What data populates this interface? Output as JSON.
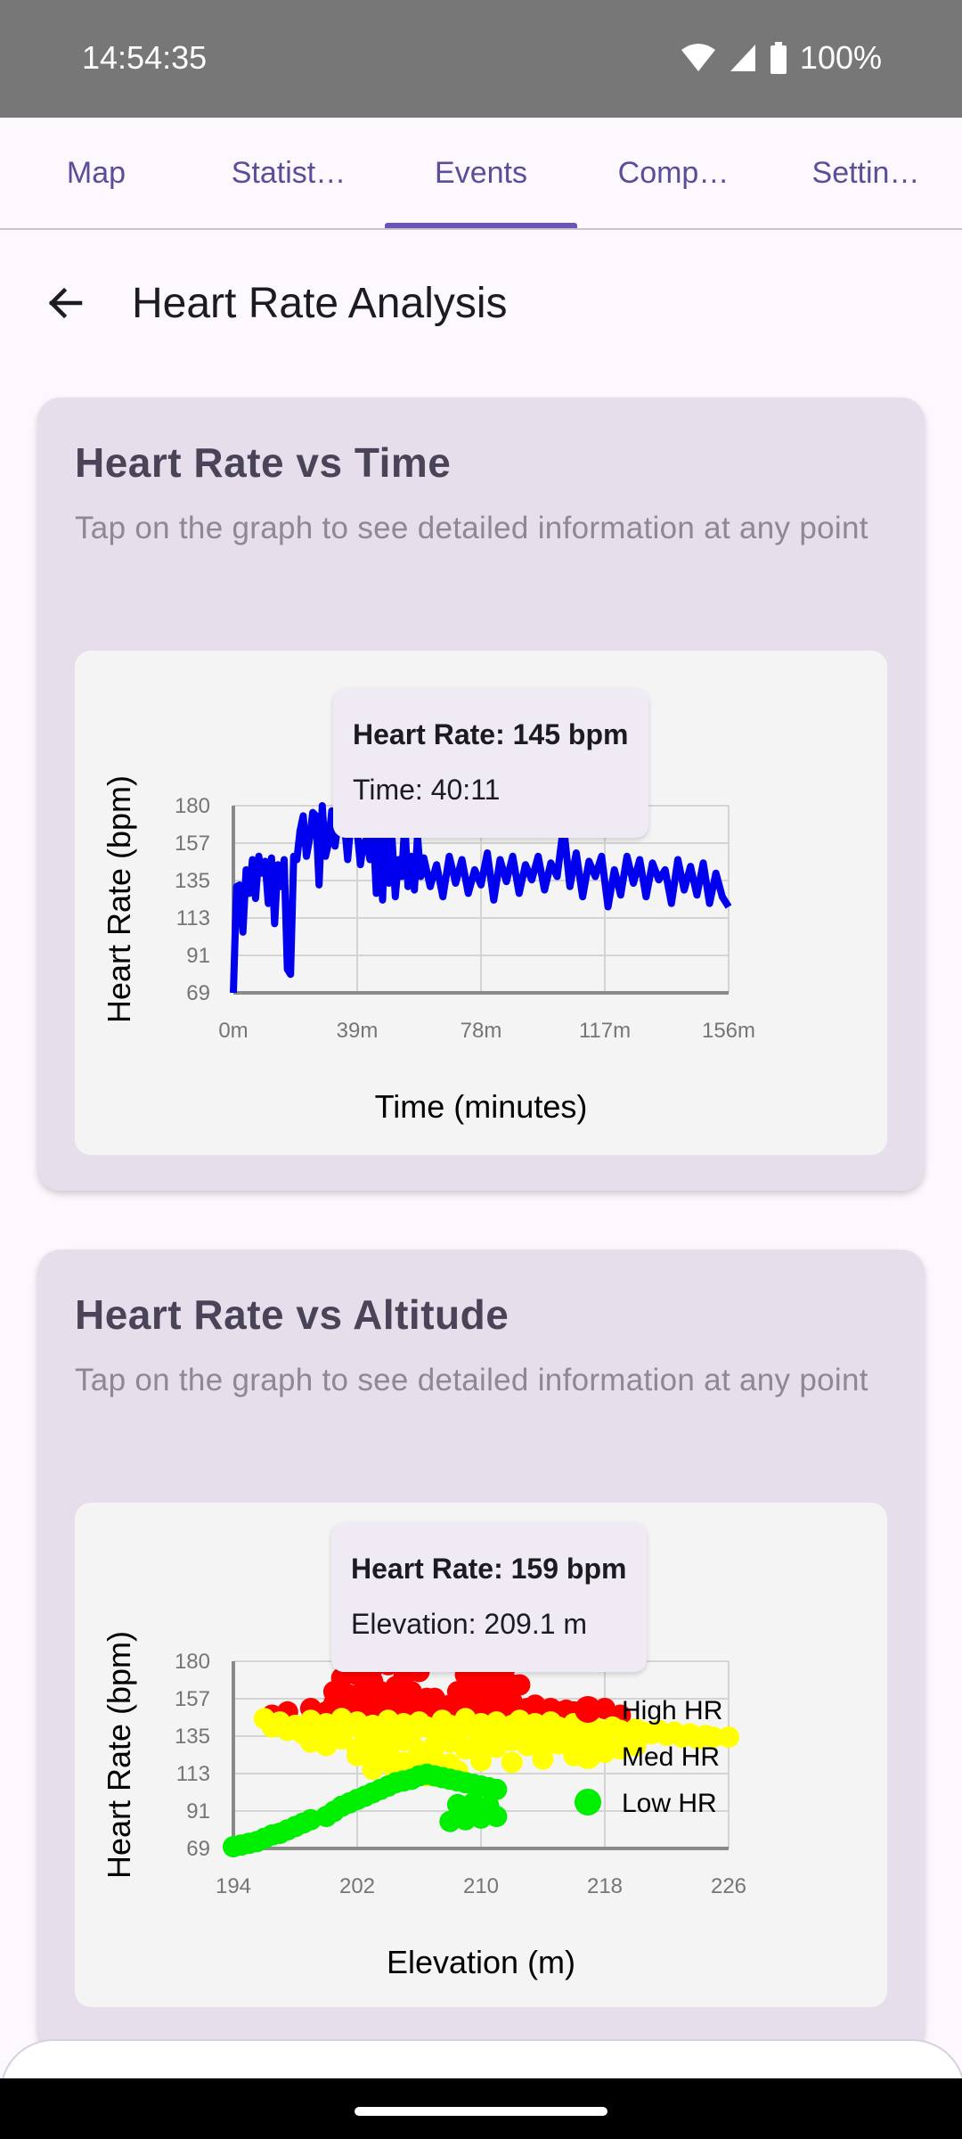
{
  "status_bar": {
    "time": "14:54:35",
    "battery": "100%"
  },
  "tabs": [
    {
      "label": "Map"
    },
    {
      "label": "Statist…"
    },
    {
      "label": "Events"
    },
    {
      "label": "Comp…"
    },
    {
      "label": "Settin…"
    }
  ],
  "active_tab": "Events",
  "header": {
    "title": "Heart Rate Analysis"
  },
  "cards": [
    {
      "title": "Heart Rate vs Time",
      "description": "Tap on the graph to see detailed information at any point",
      "tooltip": {
        "line1": "Heart Rate: 145 bpm",
        "line2": "Time: 40:11"
      }
    },
    {
      "title": "Heart Rate vs Altitude",
      "description": "Tap on the graph to see detailed information at any point",
      "tooltip": {
        "line1": "Heart Rate: 159 bpm",
        "line2": "Elevation: 209.1 m"
      }
    }
  ],
  "chart_data": [
    {
      "type": "line",
      "xlabel": "Time (minutes)",
      "ylabel": "Heart Rate (bpm)",
      "x_ticks": [
        "0m",
        "39m",
        "78m",
        "117m",
        "156m"
      ],
      "y_ticks": [
        "69",
        "91",
        "113",
        "135",
        "157",
        "180"
      ],
      "xlim": [
        0,
        156
      ],
      "ylim": [
        69,
        180
      ],
      "grid": true,
      "color": "#0000ee",
      "x": [
        0,
        1,
        2,
        3,
        4,
        5,
        6,
        7,
        8,
        9,
        10,
        11,
        12,
        13,
        14,
        15,
        16,
        17,
        18,
        19,
        20,
        21,
        22,
        23,
        24,
        25,
        26,
        27,
        28,
        29,
        30,
        31,
        32,
        33,
        34,
        35,
        36,
        37,
        38,
        39,
        40,
        41,
        42,
        43,
        44,
        45,
        46,
        47,
        48,
        49,
        50,
        51,
        52,
        53,
        54,
        55,
        56,
        57,
        58,
        59,
        60,
        62,
        64,
        66,
        68,
        70,
        72,
        74,
        76,
        78,
        80,
        82,
        84,
        86,
        88,
        90,
        92,
        94,
        96,
        98,
        100,
        102,
        104,
        106,
        108,
        110,
        112,
        114,
        116,
        118,
        120,
        122,
        124,
        126,
        128,
        130,
        132,
        134,
        136,
        138,
        140,
        142,
        144,
        146,
        148,
        150,
        152,
        154,
        156
      ],
      "y": [
        69,
        132,
        133,
        105,
        142,
        128,
        148,
        125,
        150,
        140,
        147,
        122,
        149,
        110,
        145,
        132,
        148,
        83,
        80,
        150,
        148,
        165,
        174,
        150,
        160,
        176,
        174,
        133,
        180,
        150,
        158,
        177,
        156,
        170,
        174,
        170,
        148,
        170,
        172,
        165,
        145,
        158,
        160,
        148,
        170,
        128,
        162,
        124,
        176,
        134,
        160,
        126,
        148,
        138,
        170,
        132,
        150,
        130,
        162,
        138,
        149,
        132,
        145,
        126,
        150,
        134,
        148,
        128,
        142,
        133,
        152,
        124,
        148,
        135,
        150,
        128,
        145,
        136,
        150,
        130,
        146,
        138,
        168,
        132,
        152,
        126,
        147,
        138,
        150,
        120,
        142,
        127,
        150,
        134,
        148,
        126,
        146,
        136,
        142,
        122,
        148,
        130,
        144,
        127,
        146,
        122,
        140,
        126,
        120
      ]
    },
    {
      "type": "scatter",
      "xlabel": "Elevation (m)",
      "ylabel": "Heart Rate (bpm)",
      "x_ticks": [
        "194",
        "202",
        "210",
        "218",
        "226"
      ],
      "y_ticks": [
        "69",
        "91",
        "113",
        "135",
        "157",
        "180"
      ],
      "xlim": [
        194,
        226
      ],
      "ylim": [
        69,
        180
      ],
      "grid": true,
      "legend_position": "right",
      "series": [
        {
          "name": "High HR",
          "color": "#ff0000",
          "x": [
            196.5,
            197.5,
            199,
            200,
            200.5,
            201,
            201.5,
            202,
            202.5,
            203,
            203.5,
            204,
            204.5,
            205,
            205.5,
            206,
            206.5,
            207,
            207.5,
            208,
            208.5,
            209,
            209.5,
            210,
            210.5,
            211,
            211.5,
            212,
            212.5,
            213,
            213.5,
            214,
            214.5,
            215,
            215.5,
            216,
            217,
            218,
            219,
            200.5,
            201.5,
            202.5,
            203.5,
            204.5,
            205.5,
            206.5,
            208.5,
            209.5,
            210.5,
            211.5,
            212.5,
            201,
            202,
            203,
            205,
            209,
            210,
            211,
            212,
            201.5,
            203,
            204,
            206,
            209.5,
            210.5,
            211.5,
            204,
            205,
            209,
            210,
            211
          ],
          "y": [
            148,
            150,
            152,
            150,
            155,
            158,
            152,
            150,
            156,
            153,
            158,
            150,
            154,
            160,
            150,
            155,
            152,
            158,
            150,
            154,
            150,
            156,
            160,
            152,
            158,
            154,
            150,
            156,
            150,
            152,
            154,
            150,
            152,
            150,
            151,
            150,
            150,
            152,
            148,
            162,
            160,
            166,
            162,
            165,
            162,
            158,
            162,
            168,
            164,
            162,
            166,
            170,
            172,
            168,
            170,
            172,
            168,
            170,
            166,
            175,
            176,
            178,
            174,
            176,
            178,
            175,
            180,
            178,
            180,
            178,
            180
          ]
        },
        {
          "name": "Med HR",
          "color": "#ffff00",
          "x": [
            196,
            196.5,
            197,
            197.5,
            198,
            198.5,
            199,
            199.5,
            200,
            200.5,
            201,
            201.5,
            202,
            202.5,
            203,
            203.5,
            204,
            204.5,
            205,
            205.5,
            206,
            206.5,
            207,
            207.5,
            208,
            208.5,
            209,
            209.5,
            210,
            210.5,
            211,
            211.5,
            212,
            212.5,
            213,
            213.5,
            214,
            214.5,
            215,
            215.5,
            216,
            216.5,
            217,
            217.5,
            218,
            218.5,
            219,
            219.5,
            220,
            220.5,
            221,
            221.5,
            222,
            222.5,
            223,
            223.5,
            224,
            224.5,
            225,
            226,
            199,
            200,
            201,
            202,
            203,
            204,
            205,
            206,
            207,
            208,
            209,
            210,
            211,
            212,
            213,
            214,
            215,
            216,
            217,
            218,
            219,
            220,
            202,
            203,
            204,
            205,
            206,
            207,
            208,
            210,
            212,
            214,
            216,
            218,
            203,
            204.5,
            206.5,
            208.5,
            202.5,
            204,
            205.5,
            207
          ],
          "y": [
            146,
            141,
            144,
            139,
            142,
            137,
            145,
            140,
            143,
            138,
            146,
            141,
            144,
            136,
            142,
            138,
            145,
            140,
            143,
            137,
            144,
            141,
            139,
            145,
            142,
            138,
            146,
            140,
            143,
            137,
            144,
            139,
            142,
            145,
            140,
            143,
            138,
            144,
            141,
            139,
            143,
            137,
            142,
            140,
            138,
            141,
            139,
            136,
            140,
            138,
            137,
            139,
            136,
            138,
            135,
            137,
            134,
            136,
            135,
            135,
            132,
            130,
            134,
            128,
            131,
            129,
            133,
            127,
            130,
            132,
            128,
            131,
            129,
            133,
            130,
            128,
            131,
            129,
            132,
            130,
            128,
            130,
            124,
            122,
            126,
            120,
            118,
            122,
            119,
            121,
            120,
            122,
            124,
            126,
            116,
            114,
            112,
            115,
            125,
            120,
            118,
            116
          ]
        },
        {
          "name": "Low HR",
          "color": "#00ee00",
          "x": [
            194,
            194.5,
            195,
            195.5,
            196,
            196.5,
            197,
            197.5,
            198,
            198.5,
            199,
            200,
            200.5,
            201,
            201.5,
            202,
            202.5,
            203,
            203.5,
            204,
            204.5,
            205,
            205.5,
            206,
            206.5,
            207,
            207.5,
            208,
            208.5,
            209,
            209.5,
            210,
            210.5,
            211,
            208,
            209,
            210,
            211,
            208.5,
            209.5,
            210.5
          ],
          "y": [
            70,
            71,
            72,
            73,
            75,
            77,
            78,
            80,
            82,
            84,
            86,
            88,
            91,
            94,
            96,
            98,
            100,
            102,
            104,
            106,
            108,
            109,
            110,
            112,
            113,
            112,
            111,
            110,
            109,
            108,
            107,
            106,
            105,
            104,
            85,
            86,
            87,
            88,
            95,
            96,
            94
          ]
        }
      ]
    }
  ]
}
